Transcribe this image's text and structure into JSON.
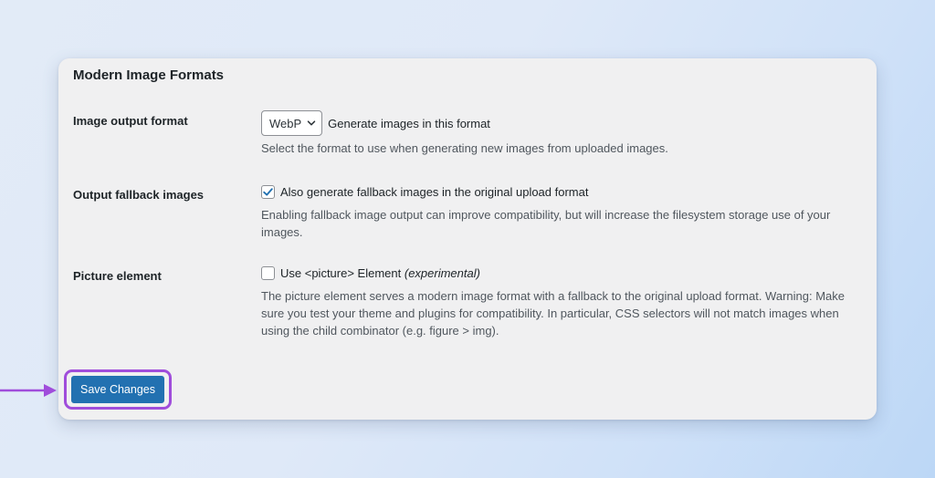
{
  "panel": {
    "title": "Modern Image Formats"
  },
  "rows": {
    "output_format": {
      "label": "Image output format",
      "select_value": "WebP",
      "inline_text": "Generate images in this format",
      "description": "Select the format to use when generating new images from uploaded images."
    },
    "fallback": {
      "label": "Output fallback images",
      "checked": true,
      "checkbox_label": "Also generate fallback images in the original upload format",
      "description": "Enabling fallback image output can improve compatibility, but will increase the filesystem storage use of your images."
    },
    "picture": {
      "label": "Picture element",
      "checked": false,
      "checkbox_label": "Use <picture> Element",
      "checkbox_label_suffix": "(experimental)",
      "description": "The picture element serves a modern image format with a fallback to the original upload format. Warning: Make sure you test your theme and plugins for compatibility. In particular, CSS selectors will not match images when using the child combinator (e.g. figure > img)."
    }
  },
  "actions": {
    "save_label": "Save Changes"
  },
  "colors": {
    "primary_button": "#2271b1",
    "highlight": "#a04ddb",
    "checkbox_check": "#2271b1"
  },
  "icons": {
    "select": "chevron-down-icon",
    "checked": "checkmark-icon",
    "pointer": "arrow-right-icon"
  }
}
